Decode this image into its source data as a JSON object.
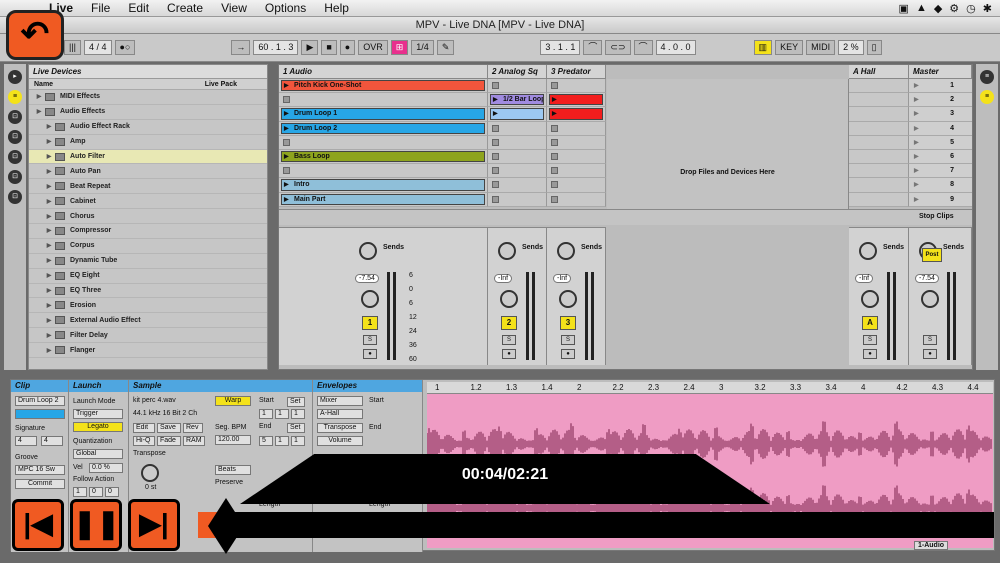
{
  "menubar": {
    "app": "Live",
    "items": [
      "File",
      "Edit",
      "Create",
      "View",
      "Options",
      "Help"
    ]
  },
  "window": {
    "title": "MPV - Live DNA  [MPV - Live DNA]"
  },
  "transport": {
    "sig": "4 / 4",
    "tempo": "60 . 1 . 3",
    "ovr": "OVR",
    "quant": "1/4",
    "position": "3 . 1 . 1",
    "loop_len": "4 . 0 . 0",
    "key": "KEY",
    "midi": "MIDI",
    "cpu": "2 %"
  },
  "browser": {
    "header": "Live Devices",
    "col_name": "Name",
    "col_pack": "Live Pack",
    "items": [
      {
        "label": "MIDI Effects",
        "indent": 0,
        "sel": false
      },
      {
        "label": "Audio Effects",
        "indent": 0,
        "sel": false
      },
      {
        "label": "Audio Effect Rack",
        "indent": 1,
        "sel": false
      },
      {
        "label": "Amp",
        "indent": 1,
        "sel": false
      },
      {
        "label": "Auto Filter",
        "indent": 1,
        "sel": true
      },
      {
        "label": "Auto Pan",
        "indent": 1,
        "sel": false
      },
      {
        "label": "Beat Repeat",
        "indent": 1,
        "sel": false
      },
      {
        "label": "Cabinet",
        "indent": 1,
        "sel": false
      },
      {
        "label": "Chorus",
        "indent": 1,
        "sel": false
      },
      {
        "label": "Compressor",
        "indent": 1,
        "sel": false
      },
      {
        "label": "Corpus",
        "indent": 1,
        "sel": false
      },
      {
        "label": "Dynamic Tube",
        "indent": 1,
        "sel": false
      },
      {
        "label": "EQ Eight",
        "indent": 1,
        "sel": false
      },
      {
        "label": "EQ Three",
        "indent": 1,
        "sel": false
      },
      {
        "label": "Erosion",
        "indent": 1,
        "sel": false
      },
      {
        "label": "External Audio Effect",
        "indent": 1,
        "sel": false
      },
      {
        "label": "Filter Delay",
        "indent": 1,
        "sel": false
      },
      {
        "label": "Flanger",
        "indent": 1,
        "sel": false
      }
    ]
  },
  "tracks": [
    {
      "name": "1 Audio",
      "clips": [
        {
          "label": "Pitch Kick One-Shot",
          "color": "#f2553c"
        },
        null,
        {
          "label": "Drum Loop 1",
          "color": "#27a6e6"
        },
        {
          "label": "Drum Loop 2",
          "color": "#27a6e6"
        },
        null,
        {
          "label": "Bass Loop",
          "color": "#8ea41d"
        },
        null,
        {
          "label": "Intro",
          "color": "#8fbfd9"
        },
        {
          "label": "Main Part",
          "color": "#8fbfd9"
        }
      ],
      "vol": "-7.54",
      "num": "1"
    },
    {
      "name": "2 Analog Sq",
      "clips": [
        null,
        {
          "label": "1/2 Bar Loop",
          "color": "#a08be0"
        },
        {
          "label": "",
          "color": "#9cc8f2"
        },
        null,
        null,
        null,
        null,
        null,
        null
      ],
      "vol": "-Inf",
      "num": "2"
    },
    {
      "name": "3 Predator",
      "clips": [
        null,
        {
          "label": "",
          "color": "#f21d1d"
        },
        {
          "label": "",
          "color": "#f21d1d"
        },
        null,
        null,
        null,
        null,
        null,
        null
      ],
      "vol": "-Inf",
      "num": "3"
    }
  ],
  "dropzone": "Drop Files and Devices Here",
  "return_track": {
    "name": "A Hall",
    "vol": "-Inf",
    "num": "A"
  },
  "master": {
    "name": "Master",
    "scenes": [
      "1",
      "2",
      "3",
      "4",
      "5",
      "6",
      "7",
      "8",
      "9"
    ],
    "stop": "Stop Clips",
    "vol": "-7.54",
    "post": "Post"
  },
  "sends_label": "Sends",
  "db_scale": [
    "6",
    "0",
    "6",
    "12",
    "24",
    "36",
    "60"
  ],
  "detail": {
    "clip": {
      "title": "Clip",
      "name": "Drum Loop 2",
      "signature": "Signature",
      "sig_num": "4",
      "sig_den": "4",
      "groove": "Groove",
      "groove_val": "MPC 16 Sw",
      "commit": "Commit"
    },
    "launch": {
      "title": "Launch",
      "mode_label": "Launch Mode",
      "mode": "Trigger",
      "legato": "Legato",
      "quant_label": "Quantization",
      "quant": "Global",
      "vel_label": "Vel",
      "vel": "0.0 %",
      "follow": "Follow Action",
      "fa1": "1",
      "fa2": "0",
      "fa3": "0"
    },
    "sample": {
      "title": "Sample",
      "file": "kit perc 4.wav",
      "info": "44.1 kHz 16 Bit 2 Ch",
      "warp": "Warp",
      "edit": "Edit",
      "save": "Save",
      "rev": "Rev",
      "hiq": "Hi-Q",
      "fade": "Fade",
      "ram": "RAM",
      "transpose": "Transpose",
      "seg_bpm": "Seg. BPM",
      "bpm": "120.00",
      "beats": "Beats",
      "preserve": "Preserve",
      "semitones": "0 st",
      "start": "Start",
      "end": "End",
      "s1": "1",
      "s2": "1",
      "s3": "1",
      "e1": "5",
      "e2": "1",
      "e3": "1",
      "set": "Set",
      "length": "Length"
    },
    "envelopes": {
      "title": "Envelopes",
      "dev": "Mixer",
      "ctrl": "A-Hall",
      "transpose": "Transpose",
      "volume": "Volume",
      "start": "Start",
      "end": "End",
      "length": "Length"
    }
  },
  "ruler": [
    "1",
    "1.2",
    "1.3",
    "1.4",
    "2",
    "2.2",
    "2.3",
    "2.4",
    "3",
    "3.2",
    "3.3",
    "3.4",
    "4",
    "4.2",
    "4.3",
    "4.4"
  ],
  "player": {
    "time": "00:04/02:21",
    "progress": 0.03
  },
  "status": {
    "track": "1-Audio"
  },
  "colors": {
    "accent": "#f05a22",
    "waveform_bg": "#ef9cc4",
    "track_yellow": "#f4e21a",
    "clip_header": "#4fa6e0"
  }
}
